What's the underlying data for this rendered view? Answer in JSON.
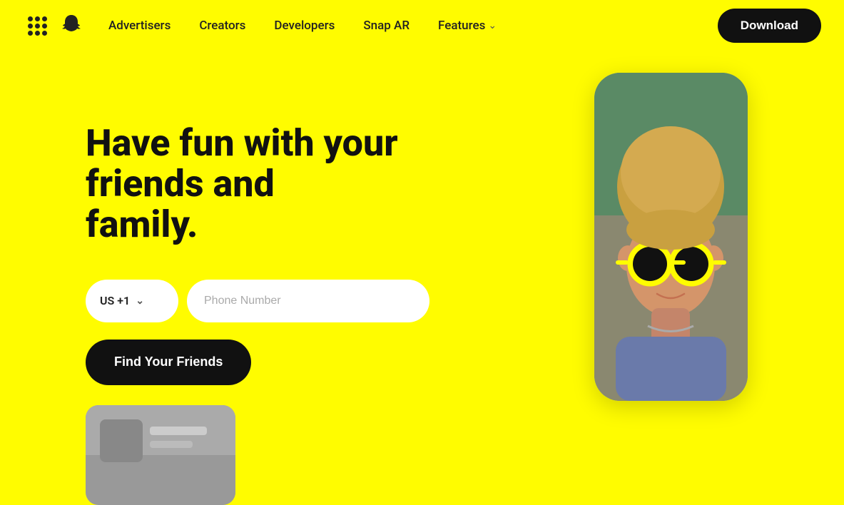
{
  "nav": {
    "grid_icon_label": "apps-menu",
    "logo_alt": "Snapchat",
    "links": [
      {
        "label": "Advertisers",
        "id": "advertisers"
      },
      {
        "label": "Creators",
        "id": "creators"
      },
      {
        "label": "Developers",
        "id": "developers"
      },
      {
        "label": "Snap AR",
        "id": "snap-ar"
      },
      {
        "label": "Features",
        "id": "features",
        "has_chevron": true
      }
    ],
    "download_label": "Download"
  },
  "hero": {
    "heading_line1": "Have fun with your friends and",
    "heading_line2": "family.",
    "country_code": "US +1",
    "phone_placeholder": "Phone Number",
    "find_button_label": "Find Your Friends"
  },
  "decorations": {
    "dash1": "yellow-dash-1",
    "dash2": "yellow-dash-2",
    "dash3": "yellow-dash-3"
  }
}
